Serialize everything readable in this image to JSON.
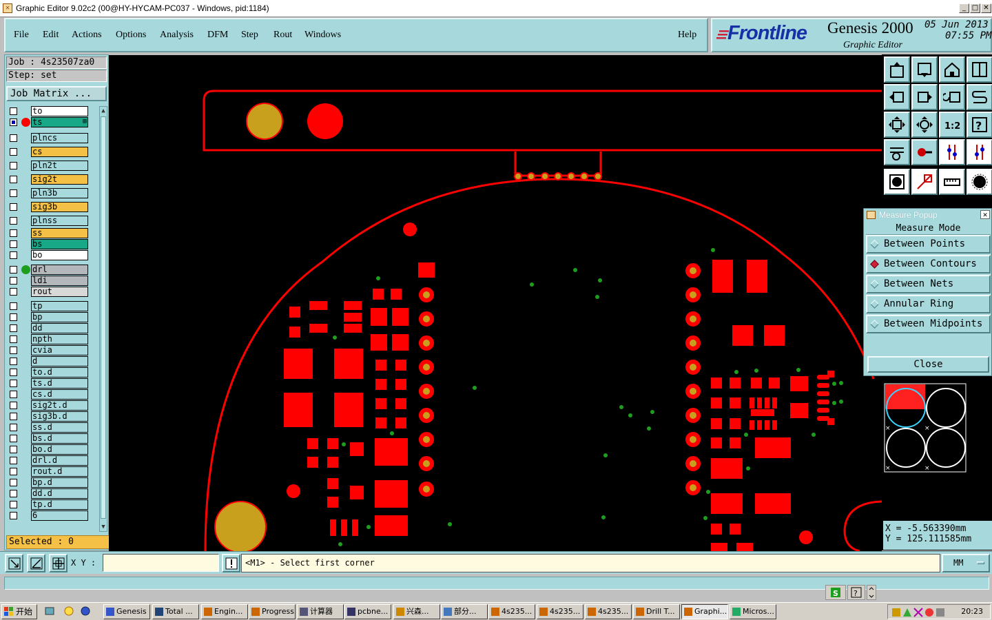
{
  "window": {
    "title": "Graphic Editor 9.02c2 (00@HY-HYCAM-PC037 - Windows, pid:1184)",
    "controls": [
      "_",
      "□",
      "✕"
    ]
  },
  "menu": {
    "items": [
      "File",
      "Edit",
      "Actions",
      "Options",
      "Analysis",
      "DFM",
      "Step",
      "Rout",
      "Windows"
    ],
    "help": "Help"
  },
  "brand": {
    "logo": "Frontline",
    "product": "Genesis 2000",
    "subtitle": "Graphic Editor",
    "date": "05 Jun 2013",
    "time": "07:55 PM"
  },
  "job": {
    "job_label": "Job : 4s23507za0",
    "step_label": "Step: set",
    "matrix_button": "Job Matrix ..."
  },
  "layers": [
    {
      "name": "to",
      "color": "#ffffff",
      "checked": false
    },
    {
      "name": "ts",
      "color": "#18a888",
      "checked": true,
      "dot": "#ff0000",
      "current": true
    },
    {
      "name": "plncs",
      "color": "#a6d8dc",
      "checked": false
    },
    {
      "name": "cs",
      "color": "#f4c046",
      "checked": false
    },
    {
      "name": "pln2t",
      "color": "#a6d8dc",
      "checked": false
    },
    {
      "name": "sig2t",
      "color": "#f4c046",
      "checked": false
    },
    {
      "name": "pln3b",
      "color": "#a6d8dc",
      "checked": false
    },
    {
      "name": "sig3b",
      "color": "#f4c046",
      "checked": false
    },
    {
      "name": "plnss",
      "color": "#a6d8dc",
      "checked": false
    },
    {
      "name": "ss",
      "color": "#f4c046",
      "checked": false
    },
    {
      "name": "bs",
      "color": "#18a888",
      "checked": false
    },
    {
      "name": "bo",
      "color": "#ffffff",
      "checked": false
    },
    {
      "name": "drl",
      "color": "#b4b8bc",
      "checked": false,
      "dot": "#1e9e1e"
    },
    {
      "name": "ldi",
      "color": "#b4b8bc",
      "checked": false
    },
    {
      "name": "rout",
      "color": "#d8d8d8",
      "checked": false
    },
    {
      "name": "tp",
      "color": "#a6d8dc",
      "checked": false
    },
    {
      "name": "bp",
      "color": "#a6d8dc",
      "checked": false
    },
    {
      "name": "dd",
      "color": "#a6d8dc",
      "checked": false
    },
    {
      "name": "npth",
      "color": "#a6d8dc",
      "checked": false
    },
    {
      "name": "cvia",
      "color": "#a6d8dc",
      "checked": false
    },
    {
      "name": "d",
      "color": "#a6d8dc",
      "checked": false
    },
    {
      "name": "to.d",
      "color": "#a6d8dc",
      "checked": false
    },
    {
      "name": "ts.d",
      "color": "#a6d8dc",
      "checked": false
    },
    {
      "name": "cs.d",
      "color": "#a6d8dc",
      "checked": false
    },
    {
      "name": "sig2t.d",
      "color": "#a6d8dc",
      "checked": false
    },
    {
      "name": "sig3b.d",
      "color": "#a6d8dc",
      "checked": false
    },
    {
      "name": "ss.d",
      "color": "#a6d8dc",
      "checked": false
    },
    {
      "name": "bs.d",
      "color": "#a6d8dc",
      "checked": false
    },
    {
      "name": "bo.d",
      "color": "#a6d8dc",
      "checked": false
    },
    {
      "name": "drl.d",
      "color": "#a6d8dc",
      "checked": false
    },
    {
      "name": "rout.d",
      "color": "#a6d8dc",
      "checked": false
    },
    {
      "name": "bp.d",
      "color": "#a6d8dc",
      "checked": false
    },
    {
      "name": "dd.d",
      "color": "#a6d8dc",
      "checked": false
    },
    {
      "name": "tp.d",
      "color": "#a6d8dc",
      "checked": false
    },
    {
      "name": "6",
      "color": "#a6d8dc",
      "checked": false
    }
  ],
  "selected_label": "Selected : 0",
  "measure": {
    "title": "Measure Popup",
    "mode_label": "Measure Mode",
    "options": [
      {
        "label": "Between Points",
        "selected": false
      },
      {
        "label": "Between Contours",
        "selected": true
      },
      {
        "label": "Between Nets",
        "selected": false
      },
      {
        "label": "Annular Ring",
        "selected": false
      },
      {
        "label": "Between Midpoints",
        "selected": false
      }
    ],
    "close_label": "Close"
  },
  "coords": {
    "x_label": "X = -5.563390mm",
    "y_label": "Y = 125.111585mm"
  },
  "command": {
    "xy_label": "X Y :",
    "xy_value": "",
    "message": "<M1> - Select first corner",
    "units": "MM"
  },
  "taskbar": {
    "start": "开始",
    "items": [
      {
        "label": "Genesis",
        "active": false
      },
      {
        "label": "Total ...",
        "active": false
      },
      {
        "label": "Engin...",
        "active": false
      },
      {
        "label": "Progress",
        "active": false
      },
      {
        "label": "计算器",
        "active": false
      },
      {
        "label": "pcbne...",
        "active": false
      },
      {
        "label": "兴森...",
        "active": false
      },
      {
        "label": "部分...",
        "active": false
      },
      {
        "label": "4s235...",
        "active": false
      },
      {
        "label": "4s235...",
        "active": false
      },
      {
        "label": "4s235...",
        "active": false
      },
      {
        "label": "Drill T...",
        "active": false
      },
      {
        "label": "Graphi...",
        "active": true
      },
      {
        "label": "Micros...",
        "active": false
      }
    ],
    "clock": "20:23"
  },
  "colors": {
    "panel": "#a6d8dc",
    "canvas": "#000000",
    "feature": "#ff0000",
    "pad_gold": "#c8a01e",
    "drill": "#1e9e1e"
  }
}
